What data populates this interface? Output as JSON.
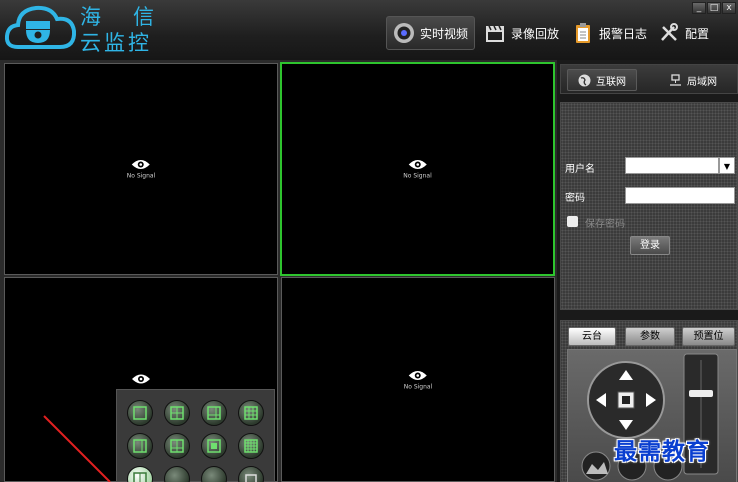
{
  "app": {
    "brand_line1": "海   信",
    "brand_line2": "云监控"
  },
  "nav": [
    {
      "label": "实时视频",
      "icon": "camera-icon"
    },
    {
      "label": "录像回放",
      "icon": "film-icon"
    },
    {
      "label": "报警日志",
      "icon": "clipboard-icon"
    },
    {
      "label": "配置",
      "icon": "tools-icon"
    }
  ],
  "window_controls": {
    "minimize": "_",
    "maximize": "□",
    "close": "x"
  },
  "video": {
    "no_signal": "No Signal"
  },
  "network_tabs": [
    {
      "label": "互联网",
      "icon": "globe-icon"
    },
    {
      "label": "局域网",
      "icon": "lan-icon"
    }
  ],
  "login": {
    "username_label": "用户名",
    "username_value": "",
    "password_label": "密码",
    "password_value": "",
    "save_password_label": "保存密码",
    "login_button": "登录"
  },
  "ptz": {
    "tabs": [
      "云台",
      "参数",
      "预置位"
    ]
  },
  "watermark": "最需教育",
  "colors": {
    "brand": "#2fb5e6",
    "selected_border": "#2ec42e",
    "watermark": "#0a3fd0"
  }
}
